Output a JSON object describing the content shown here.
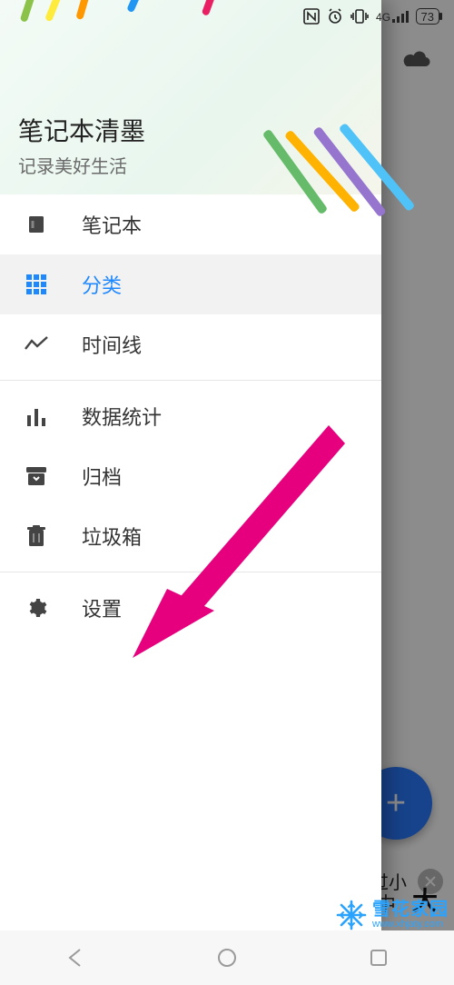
{
  "status_bar": {
    "battery_pct": "73",
    "network_label": "4G"
  },
  "background": {
    "cloud_icon_name": "cloud",
    "fab_label": "+",
    "font_hint": "体过小",
    "size_mid": "中",
    "size_large": "大"
  },
  "drawer": {
    "title": "笔记本清墨",
    "subtitle": "记录美好生活",
    "items": [
      {
        "id": "notebook",
        "label": "笔记本",
        "icon": "notebook",
        "selected": false
      },
      {
        "id": "category",
        "label": "分类",
        "icon": "grid",
        "selected": true
      },
      {
        "id": "timeline",
        "label": "时间线",
        "icon": "timeline",
        "selected": false
      },
      {
        "id": "stats",
        "label": "数据统计",
        "icon": "bars",
        "selected": false
      },
      {
        "id": "archive",
        "label": "归档",
        "icon": "archive",
        "selected": false
      },
      {
        "id": "trash",
        "label": "垃圾箱",
        "icon": "trash",
        "selected": false
      },
      {
        "id": "settings",
        "label": "设置",
        "icon": "gear",
        "selected": false
      }
    ]
  },
  "watermark": {
    "title": "雪花家园",
    "url": "www.xhjaty.com"
  }
}
